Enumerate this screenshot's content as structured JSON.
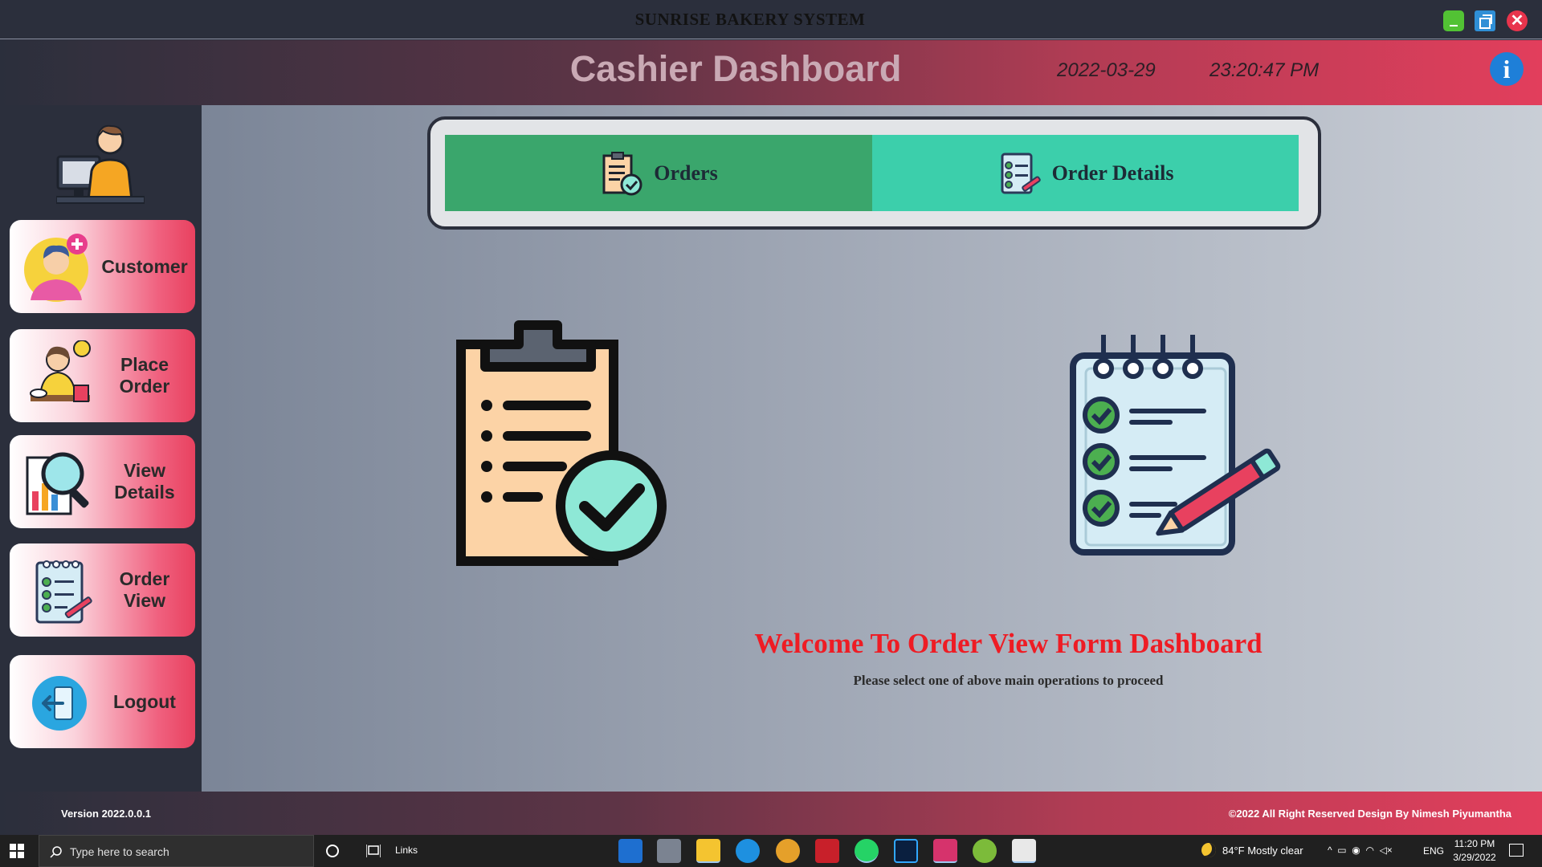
{
  "window": {
    "title": "SUNRISE BAKERY SYSTEM",
    "controls": [
      "minimize-icon",
      "maximize-icon",
      "close-icon"
    ],
    "close_glyph": "✕"
  },
  "header": {
    "title": "Cashier Dashboard",
    "date": "2022-03-29",
    "time": "23:20:47 PM",
    "info_glyph": "i"
  },
  "sidebar": {
    "items": [
      {
        "label": "Customer",
        "icon": "customer-add-icon"
      },
      {
        "label": "Place Order",
        "icon": "place-order-icon"
      },
      {
        "label": "View Details",
        "icon": "view-details-icon"
      },
      {
        "label": "Order View",
        "icon": "order-view-icon"
      },
      {
        "label": "Logout",
        "icon": "logout-icon"
      }
    ]
  },
  "tabs": [
    {
      "label": "Orders",
      "icon": "clipboard-check-icon",
      "color": "#3aa66c"
    },
    {
      "label": "Order Details",
      "icon": "notepad-icon",
      "color": "#3ccfab"
    }
  ],
  "main": {
    "welcome": "Welcome To Order View Form Dashboard",
    "subtitle": "Please select one of above main operations to proceed"
  },
  "footer": {
    "version": "Version 2022.0.0.1",
    "copyright": "©2022  All Right Reserved Design By Nimesh Piyumantha"
  },
  "taskbar": {
    "search_placeholder": "Type here to search",
    "links_label": "Links",
    "weather": "84°F  Mostly clear",
    "language": "ENG",
    "time": "11:20 PM",
    "date": "3/29/2022"
  },
  "colors": {
    "accent_red": "#ee1c24",
    "header_pink": "#e23e5c",
    "dark_bg": "#2b2f3c"
  }
}
